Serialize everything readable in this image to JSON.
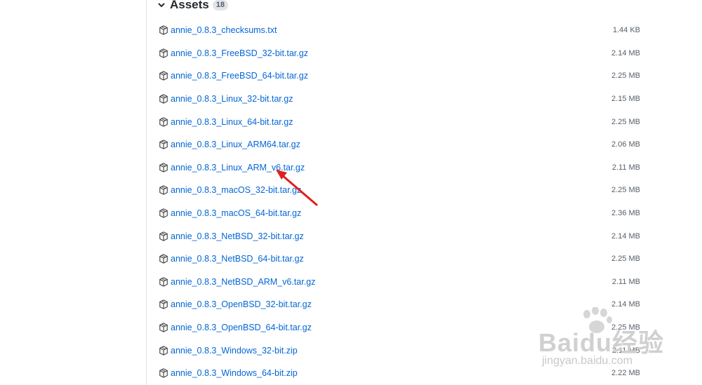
{
  "assets": {
    "title": "Assets",
    "count": "18"
  },
  "files": [
    {
      "name": "annie_0.8.3_checksums.txt",
      "size": "1.44 KB"
    },
    {
      "name": "annie_0.8.3_FreeBSD_32-bit.tar.gz",
      "size": "2.14 MB"
    },
    {
      "name": "annie_0.8.3_FreeBSD_64-bit.tar.gz",
      "size": "2.25 MB"
    },
    {
      "name": "annie_0.8.3_Linux_32-bit.tar.gz",
      "size": "2.15 MB"
    },
    {
      "name": "annie_0.8.3_Linux_64-bit.tar.gz",
      "size": "2.25 MB"
    },
    {
      "name": "annie_0.8.3_Linux_ARM64.tar.gz",
      "size": "2.06 MB"
    },
    {
      "name": "annie_0.8.3_Linux_ARM_v6.tar.gz",
      "size": "2.11 MB"
    },
    {
      "name": "annie_0.8.3_macOS_32-bit.tar.gz",
      "size": "2.25 MB"
    },
    {
      "name": "annie_0.8.3_macOS_64-bit.tar.gz",
      "size": "2.36 MB"
    },
    {
      "name": "annie_0.8.3_NetBSD_32-bit.tar.gz",
      "size": "2.14 MB"
    },
    {
      "name": "annie_0.8.3_NetBSD_64-bit.tar.gz",
      "size": "2.25 MB"
    },
    {
      "name": "annie_0.8.3_NetBSD_ARM_v6.tar.gz",
      "size": "2.11 MB"
    },
    {
      "name": "annie_0.8.3_OpenBSD_32-bit.tar.gz",
      "size": "2.14 MB"
    },
    {
      "name": "annie_0.8.3_OpenBSD_64-bit.tar.gz",
      "size": "2.25 MB"
    },
    {
      "name": "annie_0.8.3_Windows_32-bit.zip",
      "size": "2.11 MB"
    },
    {
      "name": "annie_0.8.3_Windows_64-bit.zip",
      "size": "2.22 MB"
    }
  ],
  "colors": {
    "link": "#0366d6",
    "arrow": "#e0201b",
    "muted": "#586069"
  },
  "icons": {
    "section_toggle": "chevron-down-icon",
    "file": "package-icon"
  },
  "watermark": {
    "main": "Baidu经验",
    "sub": "jingyan.baidu.com"
  }
}
